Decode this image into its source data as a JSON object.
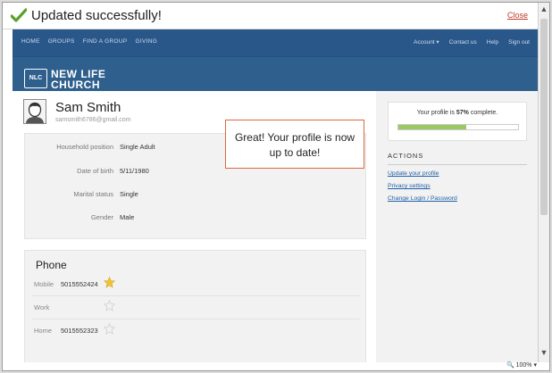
{
  "notification": {
    "message": "Updated successfully!",
    "close_label": "Close"
  },
  "nav": {
    "left": [
      "HOME",
      "GROUPS",
      "FIND A GROUP",
      "GIVING"
    ],
    "right": [
      "Account ▾",
      "Contact us",
      "Help",
      "Sign out"
    ]
  },
  "logo": {
    "badge": "NLC",
    "line1": "NEW LIFE",
    "line2": "CHURCH"
  },
  "profile": {
    "name": "Sam Smith",
    "email": "samsmith6786@gmail.com"
  },
  "details": [
    {
      "label": "Household position",
      "value": "Single Adult"
    },
    {
      "label": "Date of birth",
      "value": "5/11/1980"
    },
    {
      "label": "Marital status",
      "value": "Single"
    },
    {
      "label": "Gender",
      "value": "Male"
    }
  ],
  "tooltip": {
    "line1": "Great!  Your profile is now",
    "line2": "up to date!"
  },
  "phone": {
    "heading": "Phone",
    "rows": [
      {
        "label": "Mobile",
        "value": "5015552424",
        "primary": true
      },
      {
        "label": "Work",
        "value": "",
        "primary": false
      },
      {
        "label": "Home",
        "value": "5015552323",
        "primary": false
      }
    ]
  },
  "progress": {
    "prefix": "Your profile is ",
    "percent": "57%",
    "suffix": " complete.",
    "fraction": 0.57
  },
  "actions": {
    "heading": "ACTIONS",
    "links": [
      "Update your profile",
      "Privacy settings",
      "Change Login / Password"
    ]
  },
  "status": {
    "zoom": "100%"
  },
  "colors": {
    "nav_bg": "#29578a",
    "accent_green": "#9ac862",
    "link": "#1f5fa6",
    "tooltip_border": "#d9693e",
    "close_link": "#c0392b"
  }
}
